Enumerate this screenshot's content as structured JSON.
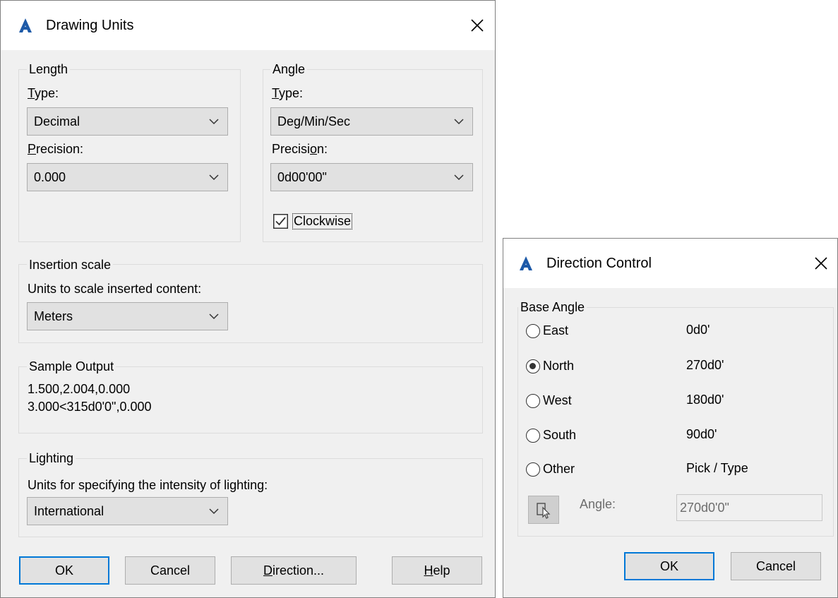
{
  "drawing_units": {
    "title": "Drawing Units",
    "length": {
      "group_label": "Length",
      "type_label": "Type:",
      "type_value": "Decimal",
      "precision_label": "Precision:",
      "precision_value": "0.000"
    },
    "angle": {
      "group_label": "Angle",
      "type_label": "Type:",
      "type_value": "Deg/Min/Sec",
      "precision_label": "Precision:",
      "precision_value": "0d00'00\"",
      "clockwise_label": "Clockwise",
      "clockwise_checked": true
    },
    "insertion": {
      "group_label": "Insertion scale",
      "desc": "Units to scale inserted content:",
      "value": "Meters"
    },
    "sample": {
      "group_label": "Sample Output",
      "line1": "1.500,2.004,0.000",
      "line2": "3.000<315d0'0\",0.000"
    },
    "lighting": {
      "group_label": "Lighting",
      "desc": "Units for specifying the intensity of lighting:",
      "value": "International"
    },
    "buttons": {
      "ok": "OK",
      "cancel": "Cancel",
      "direction": "Direction...",
      "help": "Help"
    }
  },
  "direction_control": {
    "title": "Direction Control",
    "group_label": "Base Angle",
    "options": [
      {
        "label": "East",
        "value": "0d0'",
        "selected": false
      },
      {
        "label": "North",
        "value": "270d0'",
        "selected": true
      },
      {
        "label": "West",
        "value": "180d0'",
        "selected": false
      },
      {
        "label": "South",
        "value": "90d0'",
        "selected": false
      },
      {
        "label": "Other",
        "value": "Pick / Type",
        "selected": false
      }
    ],
    "angle_label": "Angle:",
    "angle_value": "270d0'0\"",
    "buttons": {
      "ok": "OK",
      "cancel": "Cancel"
    }
  },
  "colors": {
    "logo_blue": "#1e5aa8",
    "focus_blue": "#0078d7",
    "dialog_bg": "#f0f0f0"
  },
  "icons": [
    "autocad-logo-icon",
    "close-icon",
    "chevron-down-icon",
    "checkbox-checked-icon",
    "radio-icon",
    "pick-angle-icon"
  ]
}
